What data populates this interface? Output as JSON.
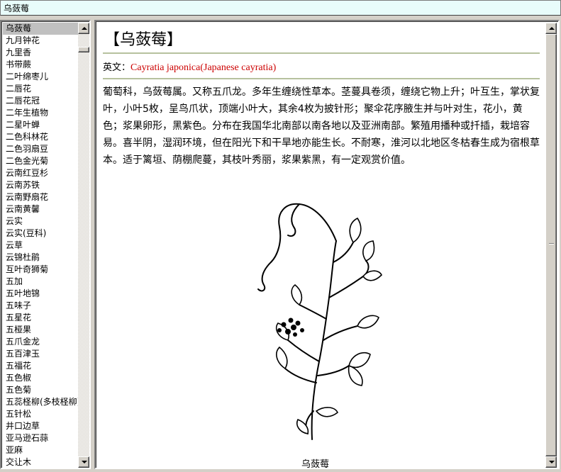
{
  "search": {
    "value": "乌蔹莓"
  },
  "list": {
    "items": [
      "乌蔹莓",
      "九月钟花",
      "九里香",
      "书带蕨",
      "二叶绵枣儿",
      "二唇花",
      "二唇花冠",
      "二年生植物",
      "二星叶蝉",
      "二色科林花",
      "二色羽扇豆",
      "二色金光菊",
      "云南红豆杉",
      "云南苏铁",
      "云南野扇花",
      "云南黄馨",
      "云实",
      "云实(豆科)",
      "云草",
      "云锦杜鹃",
      "互叶奇狮菊",
      "五加",
      "五叶地锦",
      "五味子",
      "五星花",
      "五桠果",
      "五爪金龙",
      "五百津玉",
      "五福花",
      "五色椒",
      "五色菊",
      "五蕊柽柳(多枝柽柳)",
      "五针松",
      "井口边草",
      "亚马逊石蒜",
      "亚麻",
      "交让木"
    ],
    "selected_index": 0
  },
  "entry": {
    "title": "【乌蔹莓】",
    "english_label": "英文：",
    "english_name": "Cayratia japonica(Japanese cayratia)",
    "description": "葡萄科，乌蔹莓属。又称五爪龙。多年生缠绕性草本。茎蔓具卷须，缠绕它物上升；叶互生，掌状复叶，小叶5枚，呈鸟爪状，顶端小叶大，其余4枚为披针形；聚伞花序腋生并与叶对生，花小，黄色；浆果卵形，黑紫色。分布在我国华北南部以南各地以及亚洲南部。繁殖用播种或扦插，栽培容易。喜半阴，湿润环境，但在阳光下和干旱地亦能生长。不耐寒，淮河以北地区冬枯春生成为宿根草本。适于篱垣、荫棚爬蔓，其枝叶秀丽，浆果紫黑，有一定观赏价值。",
    "figure_caption": "乌蔹莓",
    "figure_icon": "plant-illustration",
    "accent_red": "#cc0000",
    "rule_color": "#b6c19e"
  },
  "scroll": {
    "list_position": 0.02,
    "content_position": 0.5
  }
}
